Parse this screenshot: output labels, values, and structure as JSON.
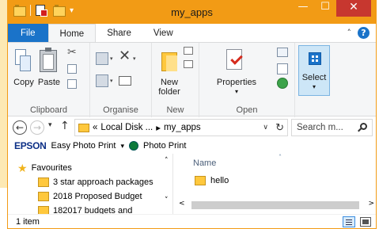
{
  "window": {
    "title": "my_apps",
    "min_glyph": "—",
    "max_glyph": "☐",
    "close_glyph": "✕"
  },
  "qat": {
    "dropdown_glyph": "▾"
  },
  "ribbon_tabs": {
    "file": "File",
    "home": "Home",
    "share": "Share",
    "view": "View"
  },
  "ribbon_controls": {
    "collapse_glyph": "˄",
    "help_glyph": "?"
  },
  "ribbon": {
    "clipboard": {
      "label": "Clipboard",
      "copy": "Copy",
      "paste": "Paste"
    },
    "organise": {
      "label": "Organise"
    },
    "new": {
      "label": "New",
      "new_folder_line1": "New",
      "new_folder_line2": "folder"
    },
    "open": {
      "label": "Open",
      "properties": "Properties",
      "properties_dd": "▾"
    },
    "select": {
      "label": "Select",
      "dd": "▾"
    },
    "glyphs": {
      "scissors": "✂",
      "delete": "✕",
      "dd": "▾"
    }
  },
  "address": {
    "back_glyph": "←",
    "forward_glyph": "→",
    "recent_glyph": "▾",
    "up_glyph": "↑",
    "path_prefix": "«",
    "segment1": "Local Disk ...",
    "separator": "▸",
    "segment2": "my_apps",
    "dropdown_glyph": "∨",
    "refresh_glyph": "↻",
    "search_placeholder": "Search m..."
  },
  "epson": {
    "brand": "EPSON",
    "app": "Easy Photo Print",
    "dd": "▾",
    "photo_print": "Photo Print"
  },
  "nav_pane": {
    "items": [
      {
        "label": "Favourites",
        "icon": "star-icon"
      },
      {
        "label": "3 star approach packages",
        "icon": "folder-icon"
      },
      {
        "label": "2018 Proposed Budget",
        "icon": "folder-icon"
      },
      {
        "label": "182017 budgets and",
        "icon": "folder-icon"
      }
    ],
    "scroll_up": "˄",
    "scroll_down": "˅"
  },
  "content": {
    "column_name": "Name",
    "sort_glyph": "˄",
    "files": [
      {
        "name": "hello",
        "icon": "folder-icon"
      }
    ],
    "scroll_left": "<",
    "scroll_right": ">"
  },
  "status": {
    "text": "1 item"
  },
  "colors": {
    "titlebar": "#f29b15",
    "file_tab": "#1a73c9",
    "close_button": "#c7372f",
    "select_highlight": "#cde6f7"
  }
}
